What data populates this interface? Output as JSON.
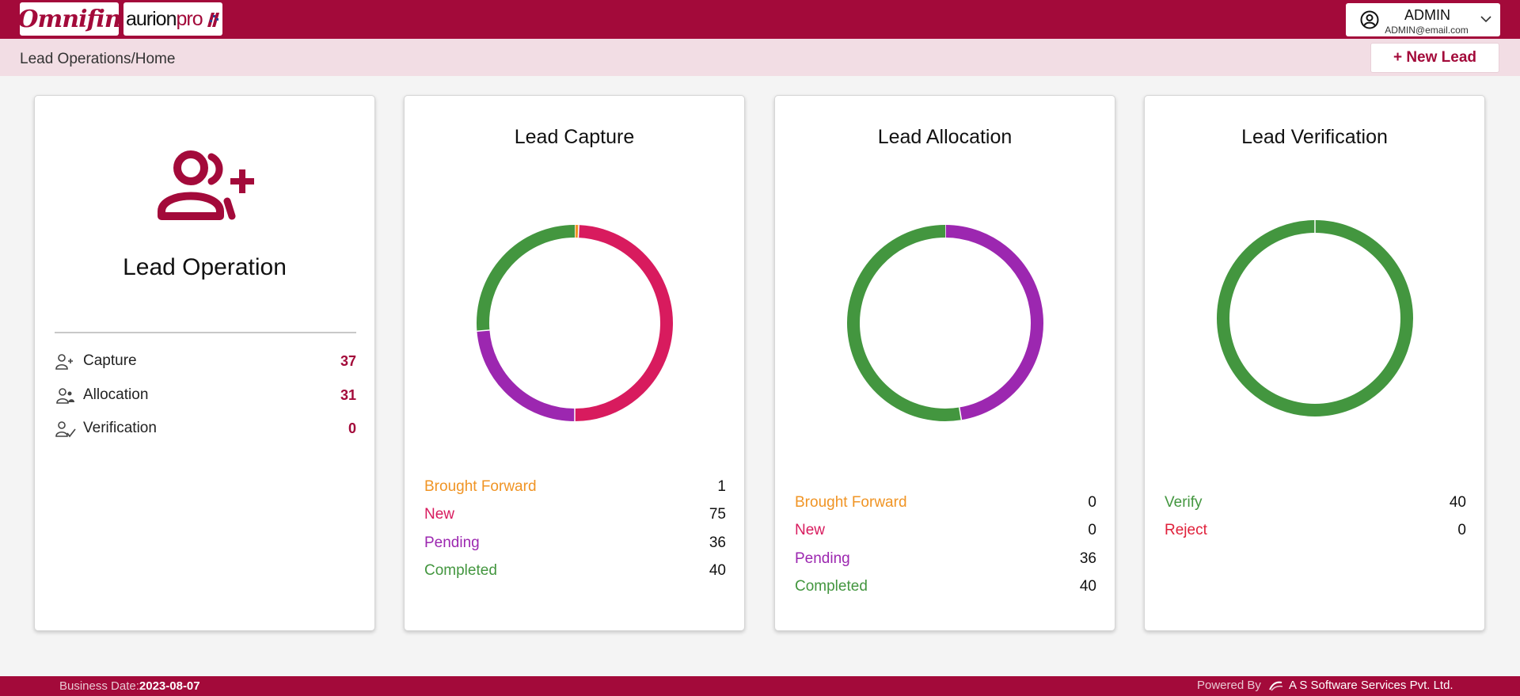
{
  "colors": {
    "brand": "#a30a3a",
    "brought_forward": "#f09424",
    "new": "#d81b5e",
    "pending": "#9c27b0",
    "completed": "#43963f",
    "verify": "#43963f",
    "reject": "#e0203a"
  },
  "header": {
    "logo_text": "Omnifin",
    "partner_logo_text": "aurion",
    "partner_logo_suffix": "pro",
    "user_name": "ADMIN",
    "user_email": "ADMIN@email.com"
  },
  "subbar": {
    "breadcrumb": "Lead Operations/Home",
    "new_lead_label": "+ New Lead"
  },
  "lead_operation": {
    "title": "Lead Operation",
    "items": [
      {
        "label": "Capture",
        "count": "37",
        "icon": "user-add-icon"
      },
      {
        "label": "Allocation",
        "count": "31",
        "icon": "users-icon"
      },
      {
        "label": "Verification",
        "count": "0",
        "icon": "user-check-icon"
      }
    ]
  },
  "chart_data": [
    {
      "type": "pie",
      "title": "Lead Capture",
      "categories": [
        "Brought Forward",
        "New",
        "Pending",
        "Completed"
      ],
      "values": [
        1,
        75,
        36,
        40
      ]
    },
    {
      "type": "pie",
      "title": "Lead Allocation",
      "categories": [
        "Brought Forward",
        "New",
        "Pending",
        "Completed"
      ],
      "values": [
        0,
        0,
        36,
        40
      ]
    },
    {
      "type": "pie",
      "title": "Lead Verification",
      "categories": [
        "Verify",
        "Reject"
      ],
      "values": [
        40,
        0
      ]
    }
  ],
  "footer": {
    "business_date_label": "Business Date:",
    "business_date": "2023-08-07",
    "powered_by": "Powered By",
    "company": "A S Software Services Pvt. Ltd."
  }
}
